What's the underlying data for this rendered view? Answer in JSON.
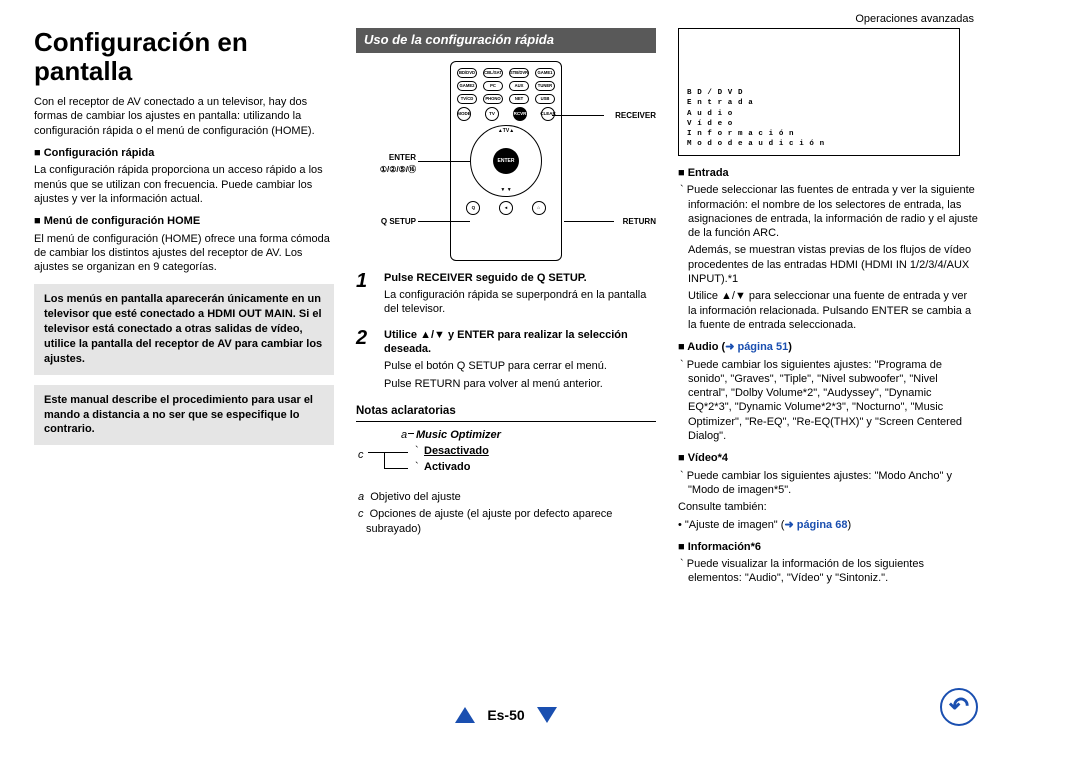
{
  "header": {
    "section": "Operaciones avanzadas"
  },
  "col1": {
    "title": "Configuración en pantalla",
    "intro": "Con el receptor de AV conectado a un televisor, hay dos formas de cambiar los ajustes en pantalla: utilizando la configuración rápida o el menú de configuración (HOME).",
    "quick_h": "Configuración rápida",
    "quick_p": "La configuración rápida proporciona un acceso rápido a los menús que se utilizan con frecuencia. Puede cambiar los ajustes y ver la información actual.",
    "home_h": "Menú de configuración HOME",
    "home_p": "El menú de configuración (HOME) ofrece una forma cómoda de cambiar los distintos ajustes del receptor de AV. Los ajustes se organizan en 9 categorías.",
    "tip1": "Los menús en pantalla aparecerán únicamente en un televisor que esté conectado a HDMI OUT MAIN. Si el televisor está conectado a otras salidas de vídeo, utilice la pantalla del receptor de AV para cambiar los ajustes.",
    "tip2": "Este manual describe el procedimiento para usar el mando a distancia a no ser que se especifique lo contrario."
  },
  "col2": {
    "bar": "Uso de la configuración rápida",
    "labels": {
      "receiver": "RECEIVER",
      "enter": "ENTER",
      "arrows": "①/②/⑤/⑯",
      "qsetup": "Q SETUP",
      "return": "RETURN"
    },
    "step1_lead": "Pulse RECEIVER seguido de Q SETUP.",
    "step1_p": "La configuración rápida se superpondrá en la pantalla del televisor.",
    "step2_lead": "Utilice ▲/▼ y ENTER para realizar la selección deseada.",
    "step2_p1": "Pulse el botón Q SETUP para cerrar el menú.",
    "step2_p2": "Pulse RETURN para volver al menú anterior.",
    "notes_h": "Notas aclaratorias",
    "diag": {
      "a": "Music Optimizer",
      "opt1": "Desactivado",
      "opt2": "Activado"
    },
    "note_a": "Objetivo del ajuste",
    "note_c": "Opciones de ajuste (el ajuste por defecto aparece subrayado)",
    "a_letter": "a",
    "c_letter": "c"
  },
  "col3": {
    "osd": [
      "B D / D V D",
      "E n t r a d a",
      "A u d i o",
      "V í d e o",
      "I n f o r m a c i ó n",
      "M o d o  d e  a u d i c i ó n"
    ],
    "entrada_h": "Entrada",
    "entrada_p1": "Puede seleccionar las fuentes de entrada y ver la siguiente información: el nombre de los selectores de entrada, las asignaciones de entrada, la información de radio y el ajuste de la función ARC.",
    "entrada_p2": "Además, se muestran vistas previas de los flujos de vídeo procedentes de las entradas HDMI (HDMI IN 1/2/3/4/AUX INPUT).*1",
    "entrada_p3": "Utilice ▲/▼ para seleccionar una fuente de entrada y ver la información relacionada. Pulsando ENTER se cambia a la fuente de entrada seleccionada.",
    "audio_h": "Audio (",
    "audio_link": "página 51",
    "audio_h_end": ")",
    "audio_p": "Puede cambiar los siguientes ajustes: \"Programa de sonido\", \"Graves\", \"Tiple\", \"Nivel subwoofer\", \"Nivel central\", \"Dolby Volume*2\", \"Audyssey\", \"Dynamic EQ*2*3\", \"Dynamic Volume*2*3\", \"Nocturno\", \"Music Optimizer\", \"Re-EQ\", \"Re-EQ(THX)\" y \"Screen Centered Dialog\".",
    "video_h": "Vídeo*4",
    "video_p1": "Puede cambiar los siguientes ajustes: \"Modo Ancho\" y \"Modo de imagen*5\".",
    "video_p2": "Consulte también:",
    "video_bullet": "• \"Ajuste de imagen\" (",
    "video_link": "página 68",
    "video_bullet_end": ")",
    "info_h": "Información*6",
    "info_p": "Puede visualizar la información de los siguientes elementos: \"Audio\", \"Vídeo\" y \"Sintoniz.\"."
  },
  "footer": {
    "page": "Es-50"
  }
}
